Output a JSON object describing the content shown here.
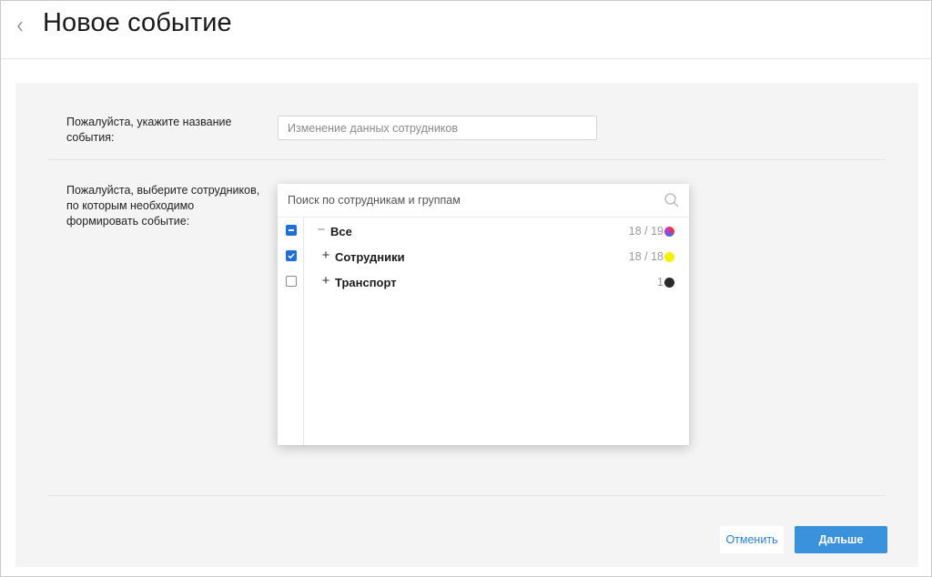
{
  "header": {
    "title": "Новое событие"
  },
  "form": {
    "name_label": "Пожалуйста, укажите название события:",
    "name_placeholder": "Изменение данных сотрудников",
    "employees_label": "Пожалуйста, выберите сотрудников, по которым необходимо формировать событие:"
  },
  "picker": {
    "search_placeholder": "Поиск по сотрудникам и группам",
    "rows": [
      {
        "toggle": "−",
        "label": "Все",
        "count": "18 / 19",
        "check_state": "partial",
        "dot": "gradient"
      },
      {
        "toggle": "+",
        "label": "Сотрудники",
        "count": "18 / 18",
        "check_state": "checked",
        "dot": "#f5f000"
      },
      {
        "toggle": "+",
        "label": "Транспорт",
        "count": "1",
        "check_state": "unchecked",
        "dot": "#2a2a2a"
      }
    ]
  },
  "actions": {
    "cancel_label": "Отменить",
    "next_label": "Дальше"
  },
  "colors": {
    "accent": "#1f6fd6",
    "primary_button": "#3a92dd",
    "panel_bg": "#f4f4f4"
  }
}
